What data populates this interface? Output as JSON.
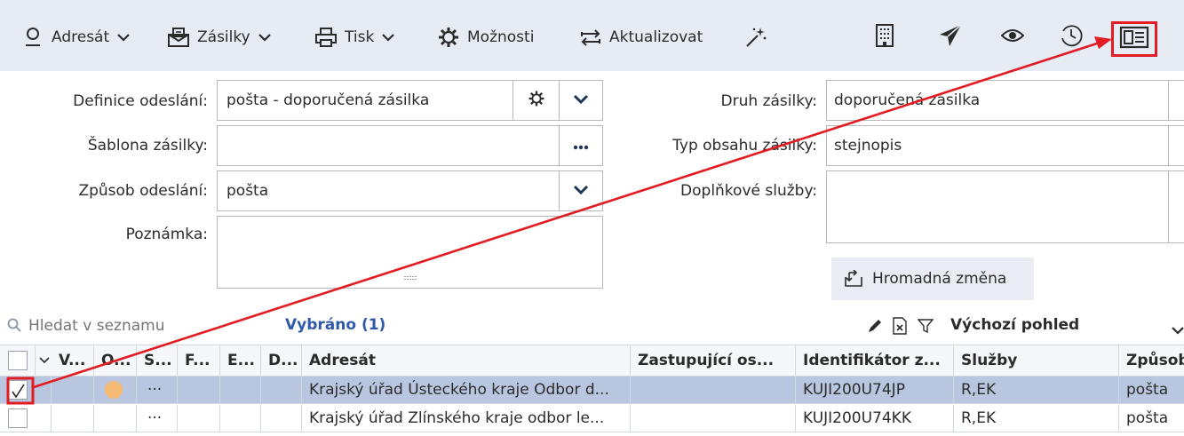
{
  "toolbar": {
    "adresat": "Adresát",
    "zasilky": "Zásilky",
    "tisk": "Tisk",
    "moznosti": "Možnosti",
    "aktualizovat": "Aktualizovat",
    "icons_right": [
      "building-icon",
      "send-plane-icon",
      "eye-icon",
      "history-icon",
      "id-card-icon"
    ]
  },
  "form": {
    "definice_label": "Definice odeslání:",
    "definice_value": "pošta - doporučená zásilka",
    "sablona_label": "Šablona zásilky:",
    "sablona_value": "",
    "zpusob_label": "Způsob odeslání:",
    "zpusob_value": "pošta",
    "poznamka_label": "Poznámka:",
    "poznamka_value": "",
    "druh_label": "Druh zásilky:",
    "druh_value": "doporučená zásilka",
    "typ_label": "Typ obsahu zásilky:",
    "typ_value": "stejnopis",
    "doplnkove_label": "Doplňkové služby:",
    "doplnkove_value": "",
    "hromadna_label": "Hromadná změna"
  },
  "list": {
    "search_placeholder": "Hledat v seznamu",
    "selected": "Vybráno (1)",
    "view": "Výchozí pohled",
    "columns": [
      "V...",
      "O...",
      "S...",
      "F...",
      "E...",
      "D...",
      "Adresát",
      "Zastupující os...",
      "Identifikátor z...",
      "Služby",
      "Způsob"
    ],
    "rows": [
      {
        "selected": true,
        "status_dot": true,
        "s": "···",
        "adresat": "Krajský úřad Ústeckého kraje Odbor d...",
        "zastupujici": "",
        "identifikator": "KUJI200U74JP",
        "sluzby": "R,EK",
        "zpusob": "pošta"
      },
      {
        "selected": false,
        "status_dot": false,
        "s": "···",
        "adresat": "Krajský úřad Zlínského kraje odbor le...",
        "zastupujici": "",
        "identifikator": "KUJI200U74KK",
        "sluzby": "R,EK",
        "zpusob": "pošta"
      }
    ]
  },
  "colors": {
    "toolbar_bg": "#e6ebf4",
    "selected_row": "#b8c6e0",
    "annotation_red": "#e31b23",
    "status_dot": "#f5b971",
    "link_blue": "#2f5aa8"
  }
}
